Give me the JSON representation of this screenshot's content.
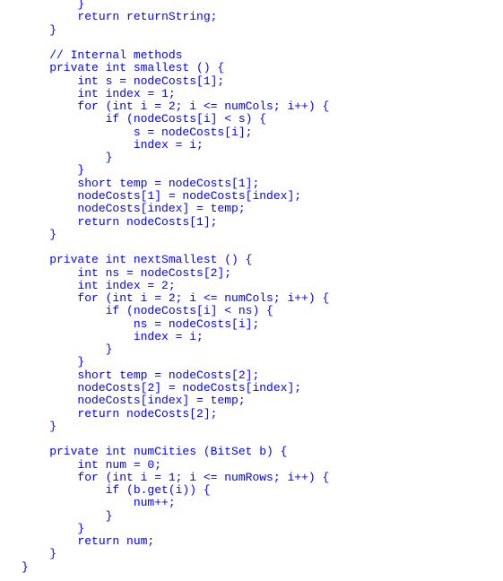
{
  "document": {
    "language": "java",
    "text_color": "#0000ff",
    "lines": [
      "        }",
      "        return returnString;",
      "    }",
      "",
      "    // Internal methods",
      "    private int smallest () {",
      "        int s = nodeCosts[1];",
      "        int index = 1;",
      "        for (int i = 2; i <= numCols; i++) {",
      "            if (nodeCosts[i] < s) {",
      "                s = nodeCosts[i];",
      "                index = i;",
      "            }",
      "        }",
      "        short temp = nodeCosts[1];",
      "        nodeCosts[1] = nodeCosts[index];",
      "        nodeCosts[index] = temp;",
      "        return nodeCosts[1];",
      "    }",
      "",
      "    private int nextSmallest () {",
      "        int ns = nodeCosts[2];",
      "        int index = 2;",
      "        for (int i = 2; i <= numCols; i++) {",
      "            if (nodeCosts[i] < ns) {",
      "                ns = nodeCosts[i];",
      "                index = i;",
      "            }",
      "        }",
      "        short temp = nodeCosts[2];",
      "        nodeCosts[2] = nodeCosts[index];",
      "        nodeCosts[index] = temp;",
      "        return nodeCosts[2];",
      "    }",
      "",
      "    private int numCities (BitSet b) {",
      "        int num = 0;",
      "        for (int i = 1; i <= numRows; i++) {",
      "            if (b.get(i)) {",
      "                num++;",
      "            }",
      "        }",
      "        return num;",
      "    }",
      "}"
    ]
  }
}
